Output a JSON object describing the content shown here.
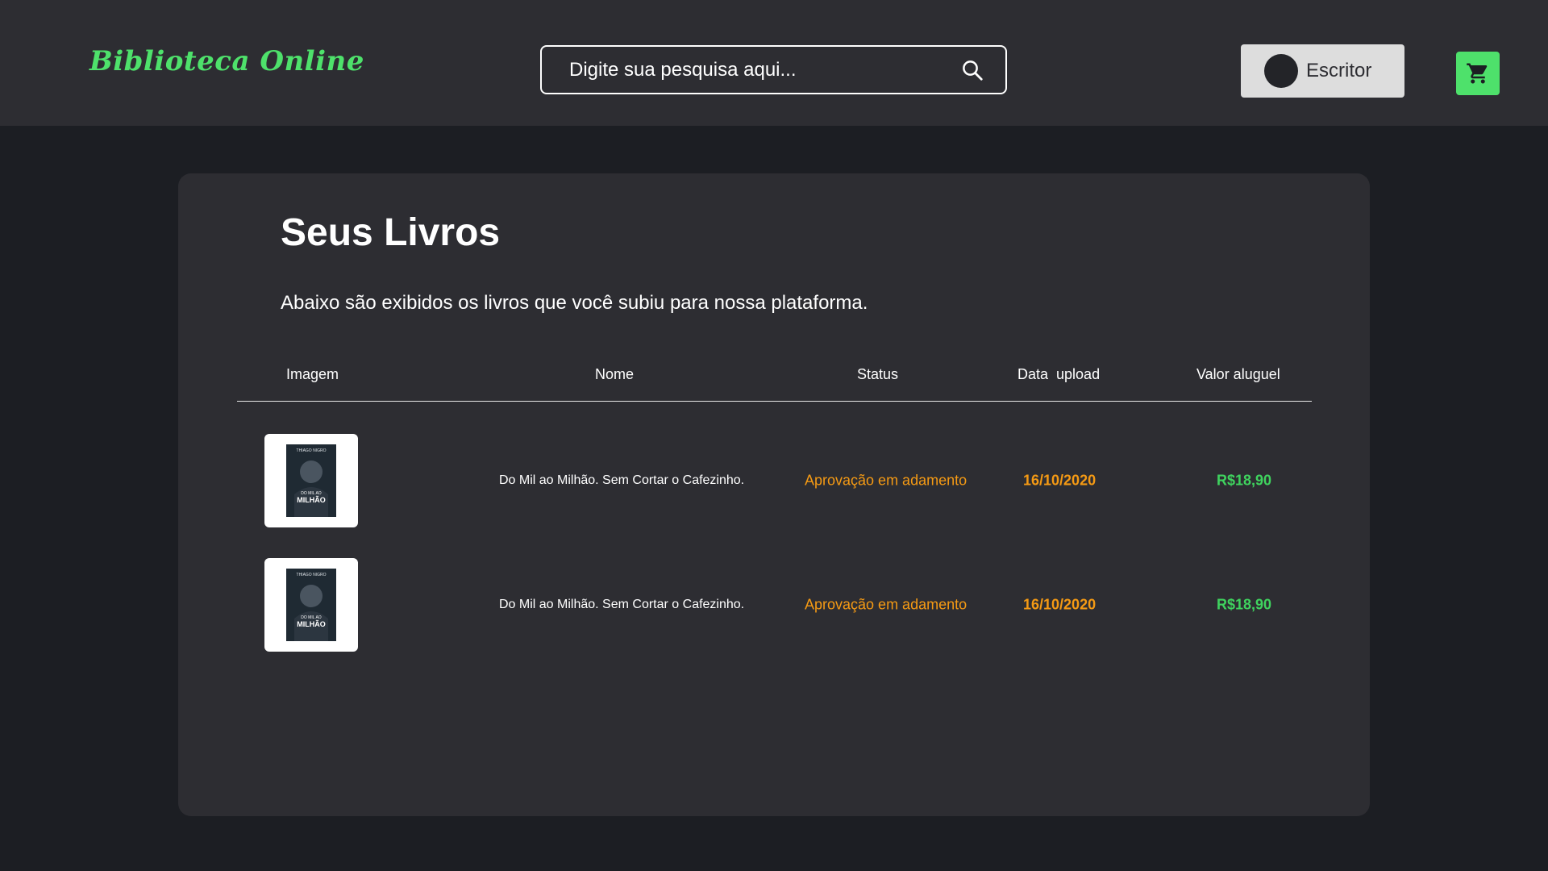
{
  "header": {
    "logo": "Biblioteca Online",
    "search": {
      "placeholder": "Digite sua pesquisa aqui...",
      "value": ""
    },
    "user_label": "Escritor",
    "icons": {
      "search": "search-icon",
      "cart": "cart-icon",
      "avatar": "avatar"
    }
  },
  "colors": {
    "brand_green": "#4ee16b",
    "status_orange": "#f59a14",
    "price_green": "#3fd35e",
    "header_bg": "#2d2d32",
    "page_bg": "#1c1e23"
  },
  "main": {
    "title": "Seus Livros",
    "description": "Abaixo são exibidos os livros que você subiu para nossa plataforma.",
    "table": {
      "headers": [
        "Imagem",
        "Nome",
        "Status",
        "Data  upload",
        "Valor aluguel"
      ],
      "rows": [
        {
          "cover_author": "THIAGO NIGRO",
          "cover_title_top": "DO MIL AO",
          "cover_title_bottom": "MILHÃO",
          "name": "Do Mil ao Milhão. Sem Cortar o Cafezinho.",
          "status": "Aprovação em adamento",
          "date": "16/10/2020",
          "price": "R$18,90"
        },
        {
          "cover_author": "THIAGO NIGRO",
          "cover_title_top": "DO MIL AO",
          "cover_title_bottom": "MILHÃO",
          "name": "Do Mil ao Milhão. Sem Cortar o Cafezinho.",
          "status": "Aprovação em adamento",
          "date": "16/10/2020",
          "price": "R$18,90"
        }
      ]
    }
  }
}
